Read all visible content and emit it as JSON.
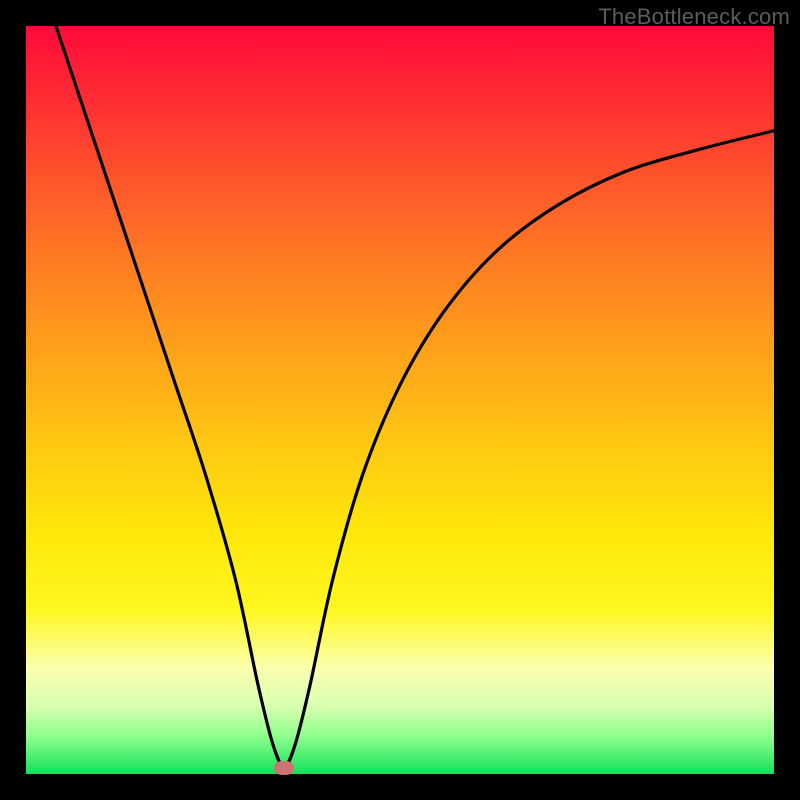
{
  "watermark": "TheBottleneck.com",
  "chart_data": {
    "type": "line",
    "title": "",
    "xlabel": "",
    "ylabel": "",
    "xlim": [
      0,
      100
    ],
    "ylim": [
      0,
      100
    ],
    "grid": false,
    "legend": false,
    "series": [
      {
        "name": "bottleneck-curve",
        "x": [
          4,
          8,
          12,
          16,
          20,
          24,
          28,
          31,
          33,
          34.5,
          36,
          38,
          41,
          45,
          50,
          56,
          63,
          71,
          80,
          90,
          100
        ],
        "y": [
          100,
          88,
          76,
          64,
          52,
          40,
          26,
          12,
          4,
          1,
          4,
          12,
          26,
          40,
          52,
          62,
          70,
          76,
          80.5,
          83.5,
          86
        ]
      }
    ],
    "minimum_marker": {
      "x": 34.5,
      "y": 0.8
    },
    "colors": {
      "gradient_top": "#ff0a3a",
      "gradient_bottom": "#14e05a",
      "curve": "#000000",
      "marker": "#cf7272",
      "frame": "#000000"
    }
  }
}
